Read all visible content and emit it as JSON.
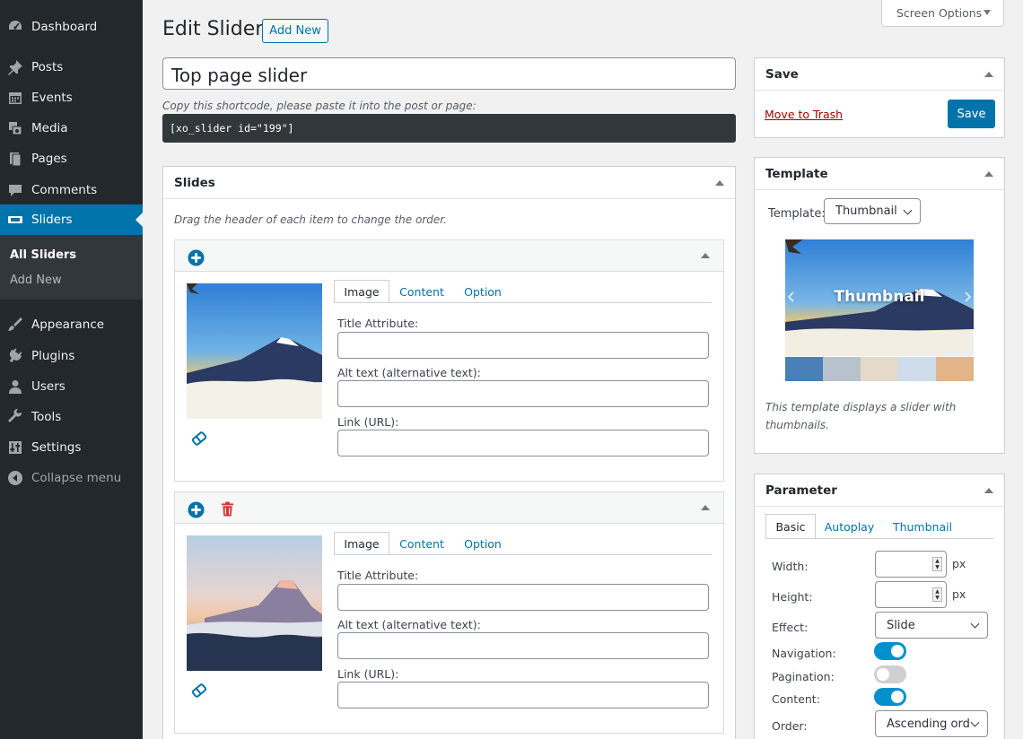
{
  "menu": {
    "dashboard": "Dashboard",
    "posts": "Posts",
    "events": "Events",
    "media": "Media",
    "pages": "Pages",
    "comments": "Comments",
    "sliders": "Sliders",
    "all_sliders": "All Sliders",
    "add_new": "Add New",
    "appearance": "Appearance",
    "plugins": "Plugins",
    "users": "Users",
    "tools": "Tools",
    "settings": "Settings",
    "collapse": "Collapse menu"
  },
  "header": {
    "screen_options": "Screen Options",
    "title": "Edit Slider",
    "add_new": "Add New"
  },
  "slider": {
    "title_value": "Top page slider",
    "shortcode_hint": "Copy this shortcode, please paste it into the post or page:",
    "shortcode": "[xo_slider id=\"199\"]"
  },
  "slides": {
    "title": "Slides",
    "hint": "Drag the header of each item to change the order.",
    "tabs": [
      "Image",
      "Content",
      "Option"
    ],
    "field_title": "Title Attribute:",
    "field_alt": "Alt text (alternative text):",
    "field_link": "Link (URL):"
  },
  "save": {
    "title": "Save",
    "trash": "Move to Trash",
    "button": "Save"
  },
  "template": {
    "title": "Template",
    "label": "Template:",
    "value": "Thumbnail",
    "preview_text": "Thumbnail",
    "description": "This template displays a slider with thumbnails."
  },
  "parameter": {
    "title": "Parameter",
    "tabs": [
      "Basic",
      "Autoplay",
      "Thumbnail"
    ],
    "width_label": "Width:",
    "height_label": "Height:",
    "unit": "px",
    "effect_label": "Effect:",
    "effect_value": "Slide",
    "navigation_label": "Navigation:",
    "navigation_on": true,
    "pagination_label": "Pagination:",
    "pagination_on": false,
    "content_label": "Content:",
    "content_on": true,
    "order_label": "Order:",
    "order_value": "Ascending ord"
  },
  "colors": {
    "accent": "#0073aa",
    "sidebar": "#23282d",
    "toggle_on": "#0091cd",
    "trash_red": "#dc3232"
  }
}
